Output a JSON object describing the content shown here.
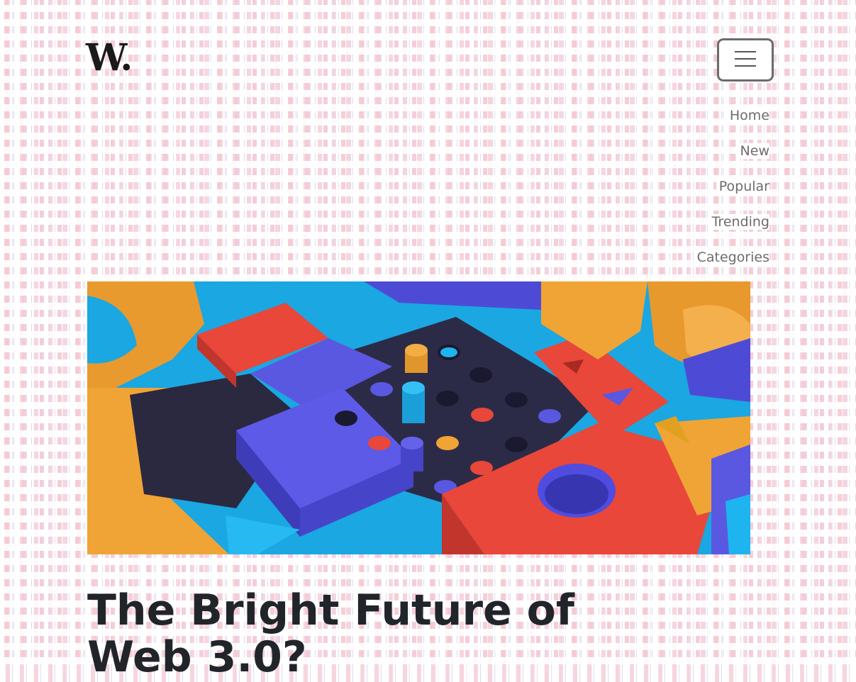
{
  "brand": {
    "logo_text": "W."
  },
  "menu_toggle": {
    "icon": "hamburger-icon"
  },
  "nav": {
    "items": [
      {
        "label": "Home"
      },
      {
        "label": "New"
      },
      {
        "label": "Popular"
      },
      {
        "label": "Trending"
      },
      {
        "label": "Categories"
      }
    ]
  },
  "hero_image": {
    "alt": "colorful 3D wooden blocks and pegs on a board"
  },
  "article": {
    "title": "The Bright Future of Web 3.0?"
  },
  "colors": {
    "text_dark": "#212529",
    "nav_text": "#6c6c6c",
    "toggle_border": "#6b6b6b",
    "block_orange": "#f0a436",
    "block_red": "#e8473a",
    "block_blue": "#5a58e0",
    "block_cyan": "#1db4f0",
    "board_dark": "#2c2b47"
  }
}
